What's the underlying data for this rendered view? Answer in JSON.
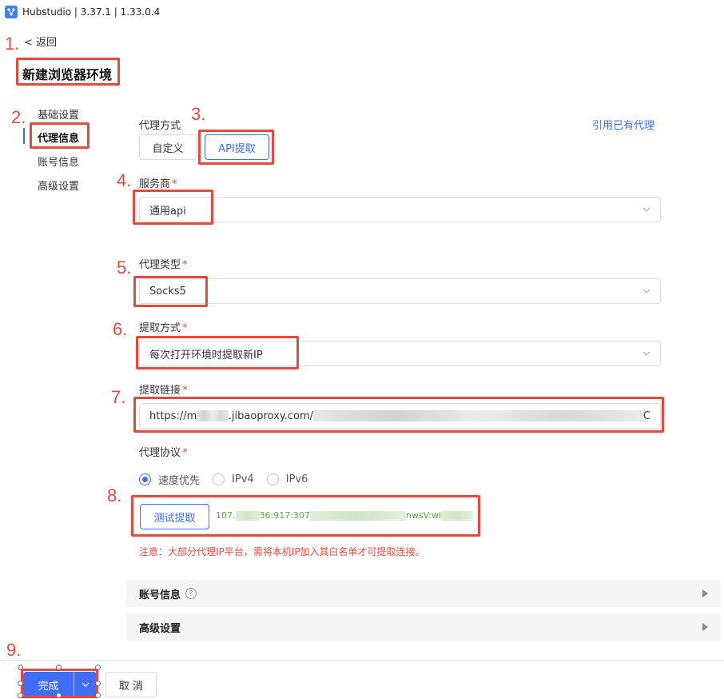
{
  "titlebar": {
    "title": "Hubstudio | 3.37.1 | 1.33.0.4",
    "icon": "hubstudio-logo-icon"
  },
  "back": {
    "label": "< 返回"
  },
  "page_title": "新建浏览器环境",
  "nav": {
    "items": [
      {
        "label": "基础设置"
      },
      {
        "label": "代理信息"
      },
      {
        "label": "账号信息"
      },
      {
        "label": "高级设置"
      }
    ],
    "active_index": 1
  },
  "proxy_mode": {
    "label": "代理方式",
    "options": [
      "自定义",
      "API提取"
    ],
    "selected": "API提取",
    "use_existing_link": "引用已有代理"
  },
  "provider": {
    "label": "服务商",
    "value": "通用api"
  },
  "proxy_type": {
    "label": "代理类型",
    "value": "Socks5"
  },
  "extract_method": {
    "label": "提取方式",
    "value": "每次打开环境时提取新IP"
  },
  "extract_link": {
    "label": "提取链接",
    "value_visible_start": "https://m",
    "value_visible_mid": ".jibaoproxy.com/",
    "value_visible_end": "C"
  },
  "protocol": {
    "label": "代理协议",
    "options": [
      "速度优先",
      "IPv4",
      "IPv6"
    ],
    "selected": "速度优先"
  },
  "test": {
    "button_label": "测试提取",
    "result_part1": "107.",
    "result_part2": "36:917:307",
    "result_part3": "nwsV:wi"
  },
  "note": "注意：大部分代理IP平台，需将本机IP加入其白名单才可提取连接。",
  "sections": [
    {
      "title": "账号信息",
      "has_help": true
    },
    {
      "title": "高级设置",
      "has_help": false
    }
  ],
  "footer": {
    "done_label": "完成",
    "cancel_label": "取 消"
  },
  "annotations": [
    "1.",
    "2.",
    "3.",
    "4.",
    "5.",
    "6.",
    "7.",
    "8.",
    "9."
  ],
  "colors": {
    "accent": "#3f6df5",
    "annotation_red": "#e8493f",
    "success_green": "#5aa33a"
  }
}
